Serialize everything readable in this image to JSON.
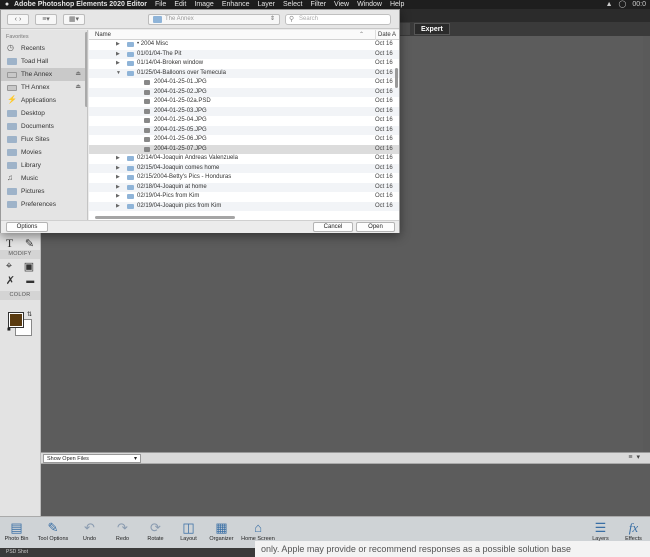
{
  "menubar": {
    "app_name": "Adobe Photoshop Elements 2020 Editor",
    "menus": [
      "File",
      "Edit",
      "Image",
      "Enhance",
      "Layer",
      "Select",
      "Filter",
      "View",
      "Window",
      "Help"
    ],
    "clock": "00:0"
  },
  "modes": {
    "expert": "Expert"
  },
  "dialog": {
    "location": "The Annex",
    "search_placeholder": "Search",
    "sidebar": {
      "heading": "Favorites",
      "items": [
        {
          "label": "Recents",
          "icon": "clock-icon"
        },
        {
          "label": "Toad Hall",
          "icon": "folder-icon"
        },
        {
          "label": "The Annex",
          "icon": "drive-icon",
          "eject": true,
          "selected": true
        },
        {
          "label": "TH Annex",
          "icon": "drive-icon",
          "eject": true
        },
        {
          "label": "Applications",
          "icon": "applications-icon"
        },
        {
          "label": "Desktop",
          "icon": "folder-icon"
        },
        {
          "label": "Documents",
          "icon": "folder-icon"
        },
        {
          "label": "Flux Sites",
          "icon": "folder-icon"
        },
        {
          "label": "Movies",
          "icon": "folder-icon"
        },
        {
          "label": "Library",
          "icon": "folder-icon"
        },
        {
          "label": "Music",
          "icon": "music-icon"
        },
        {
          "label": "Pictures",
          "icon": "folder-icon"
        },
        {
          "label": "Preferences",
          "icon": "folder-icon"
        }
      ]
    },
    "columns": {
      "name": "Name",
      "date": "Date A"
    },
    "files": [
      {
        "name": "• 2004 Misc",
        "date": "Oct 16",
        "type": "folder",
        "level": 1,
        "expanded": false
      },
      {
        "name": "01/01/04-The Pit",
        "date": "Oct 16",
        "type": "folder",
        "level": 1,
        "expanded": false
      },
      {
        "name": "01/14/04-Broken window",
        "date": "Oct 16",
        "type": "folder",
        "level": 1,
        "expanded": false
      },
      {
        "name": "01/25/04-Balloons over Temecula",
        "date": "Oct 16",
        "type": "folder",
        "level": 1,
        "expanded": true
      },
      {
        "name": "2004-01-25-01.JPG",
        "date": "Oct 16",
        "type": "image",
        "level": 2
      },
      {
        "name": "2004-01-25-02.JPG",
        "date": "Oct 16",
        "type": "image",
        "level": 2
      },
      {
        "name": "2004-01-25-02a.PSD",
        "date": "Oct 16",
        "type": "image",
        "level": 2
      },
      {
        "name": "2004-01-25-03.JPG",
        "date": "Oct 16",
        "type": "image",
        "level": 2
      },
      {
        "name": "2004-01-25-04.JPG",
        "date": "Oct 16",
        "type": "image",
        "level": 2
      },
      {
        "name": "2004-01-25-05.JPG",
        "date": "Oct 16",
        "type": "image",
        "level": 2
      },
      {
        "name": "2004-01-25-06.JPG",
        "date": "Oct 16",
        "type": "image",
        "level": 2
      },
      {
        "name": "2004-01-25-07.JPG",
        "date": "Oct 16",
        "type": "image",
        "level": 2,
        "selected": true
      },
      {
        "name": "02/14/04-Joaquin Andreas Valenzuela",
        "date": "Oct 16",
        "type": "folder",
        "level": 1,
        "expanded": false
      },
      {
        "name": "02/15/04-Joaquin comes home",
        "date": "Oct 16",
        "type": "folder",
        "level": 1,
        "expanded": false
      },
      {
        "name": "02/15/2004-Betty's Pics - Honduras",
        "date": "Oct 16",
        "type": "folder",
        "level": 1,
        "expanded": false
      },
      {
        "name": "02/18/04-Joaquin at home",
        "date": "Oct 16",
        "type": "folder",
        "level": 1,
        "expanded": false
      },
      {
        "name": "02/19/04-Pics from Kim",
        "date": "Oct 16",
        "type": "folder",
        "level": 1,
        "expanded": false
      },
      {
        "name": "02/19/04-Joaquin pics from Kim",
        "date": "Oct 16",
        "type": "folder",
        "level": 1,
        "expanded": false
      }
    ],
    "buttons": {
      "options": "Options",
      "cancel": "Cancel",
      "open": "Open"
    }
  },
  "tool_panel": {
    "modify_label": "MODIFY",
    "color_label": "COLOR",
    "foreground_color": "#5a3b10",
    "background_color": "#ffffff"
  },
  "photo_bin": {
    "show_label": "Show Open Files"
  },
  "taskbar": {
    "left": [
      {
        "label": "Photo Bin",
        "icon": "photo-bin-icon"
      },
      {
        "label": "Tool Options",
        "icon": "tool-options-icon"
      },
      {
        "label": "Undo",
        "icon": "undo-icon"
      },
      {
        "label": "Redo",
        "icon": "redo-icon"
      },
      {
        "label": "Rotate",
        "icon": "rotate-icon"
      },
      {
        "label": "Layout",
        "icon": "layout-icon"
      },
      {
        "label": "Organizer",
        "icon": "organizer-icon"
      },
      {
        "label": "Home Screen",
        "icon": "home-screen-icon"
      }
    ],
    "right": [
      {
        "label": "Layers",
        "icon": "layers-icon"
      },
      {
        "label": "Effects",
        "icon": "effects-icon"
      }
    ]
  },
  "caption": "only. Apple may provide or recommend responses as a possible solution base",
  "dock_text": "PSD Shot"
}
